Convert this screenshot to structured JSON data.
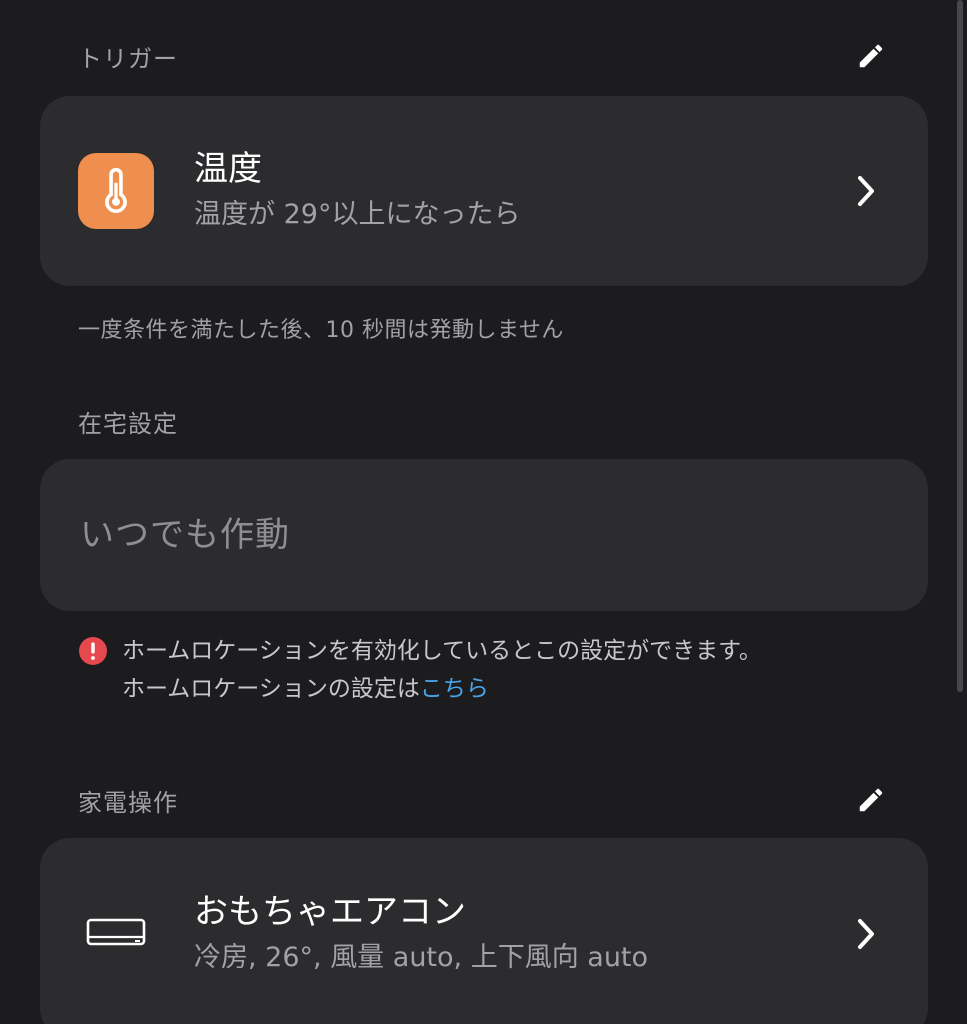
{
  "trigger": {
    "section_title": "トリガー",
    "card": {
      "title": "温度",
      "subtitle": "温度が 29°以上になったら",
      "icon": "thermometer-icon",
      "icon_bg": "#ee8f4f"
    },
    "note": "一度条件を満たした後、10 秒間は発動しません"
  },
  "presence": {
    "section_title": "在宅設定",
    "value": "いつでも作動",
    "warning_line1": "ホームロケーションを有効化しているとこの設定ができます。",
    "warning_line2": "ホームロケーションの設定は",
    "warning_link": "こちら",
    "warning_color": "#e5484d",
    "link_color": "#4aa3e8"
  },
  "appliance": {
    "section_title": "家電操作",
    "card": {
      "title": "おもちゃエアコン",
      "subtitle": "冷房, 26°, 風量 auto, 上下風向 auto",
      "icon": "air-conditioner-icon"
    }
  }
}
